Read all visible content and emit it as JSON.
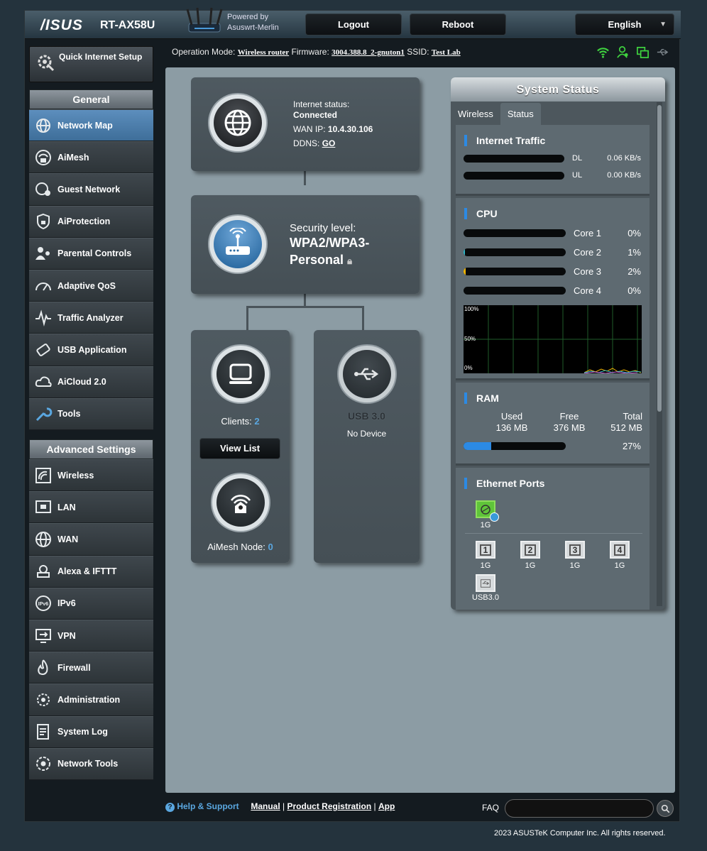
{
  "header": {
    "logo": "/ISUS",
    "model": "RT-AX58U",
    "powered_by": "Powered by",
    "firmware_brand": "Asuswrt-Merlin",
    "logout": "Logout",
    "reboot": "Reboot",
    "language": "English"
  },
  "info_bar": {
    "op_mode_label": "Operation Mode:",
    "op_mode_value": "Wireless router",
    "firmware_label": "Firmware:",
    "firmware_value": "3004.388.8_2-gnuton1",
    "ssid_label": "SSID:",
    "ssid_value": "Test Lab"
  },
  "sidebar": {
    "quick_setup": "Quick Internet Setup",
    "general_title": "General",
    "general_items": [
      {
        "label": "Network Map",
        "icon": "network-map-icon",
        "active": true
      },
      {
        "label": "AiMesh",
        "icon": "aimesh-icon"
      },
      {
        "label": "Guest Network",
        "icon": "guest-network-icon"
      },
      {
        "label": "AiProtection",
        "icon": "aiprotection-icon"
      },
      {
        "label": "Parental Controls",
        "icon": "parental-controls-icon"
      },
      {
        "label": "Adaptive QoS",
        "icon": "adaptive-qos-icon"
      },
      {
        "label": "Traffic Analyzer",
        "icon": "traffic-analyzer-icon"
      },
      {
        "label": "USB Application",
        "icon": "usb-application-icon"
      },
      {
        "label": "AiCloud 2.0",
        "icon": "aicloud-icon"
      },
      {
        "label": "Tools",
        "icon": "tools-icon"
      }
    ],
    "advanced_title": "Advanced Settings",
    "advanced_items": [
      {
        "label": "Wireless",
        "icon": "wireless-icon"
      },
      {
        "label": "LAN",
        "icon": "lan-icon"
      },
      {
        "label": "WAN",
        "icon": "wan-icon"
      },
      {
        "label": "Alexa & IFTTT",
        "icon": "alexa-icon"
      },
      {
        "label": "IPv6",
        "icon": "ipv6-icon"
      },
      {
        "label": "VPN",
        "icon": "vpn-icon"
      },
      {
        "label": "Firewall",
        "icon": "firewall-icon"
      },
      {
        "label": "Administration",
        "icon": "administration-icon"
      },
      {
        "label": "System Log",
        "icon": "system-log-icon"
      },
      {
        "label": "Network Tools",
        "icon": "network-tools-icon"
      }
    ]
  },
  "network_map": {
    "internet_status_label": "Internet status:",
    "internet_status_value": "Connected",
    "wan_ip_label": "WAN IP:",
    "wan_ip_value": "10.4.30.106",
    "ddns_label": "DDNS:",
    "ddns_value": "GO",
    "security_level_label": "Security level:",
    "security_value_line1": "WPA2/WPA3-",
    "security_value_line2": "Personal",
    "clients_label": "Clients:",
    "clients_count": "2",
    "view_list": "View List",
    "aimesh_label": "AiMesh Node:",
    "aimesh_count": "0",
    "usb_label": "USB 3.0",
    "usb_status": "No Device"
  },
  "system_status": {
    "title": "System Status",
    "tab_wireless": "Wireless",
    "tab_status": "Status",
    "traffic": {
      "title": "Internet Traffic",
      "dl_label": "DL",
      "dl_value": "0.06 KB/s",
      "ul_label": "UL",
      "ul_value": "0.00 KB/s"
    },
    "cpu": {
      "title": "CPU",
      "cores": [
        {
          "label": "Core 1",
          "value": "0%",
          "pct": 0,
          "color": "#2c8ae4"
        },
        {
          "label": "Core 2",
          "value": "1%",
          "pct": 1,
          "color": "#2fb7c9"
        },
        {
          "label": "Core 3",
          "value": "2%",
          "pct": 2,
          "color": "#f0b400"
        },
        {
          "label": "Core 4",
          "value": "0%",
          "pct": 0,
          "color": "#2c8ae4"
        }
      ],
      "graph_100": "100%",
      "graph_50": "50%",
      "graph_0": "0%"
    },
    "ram": {
      "title": "RAM",
      "used_label": "Used",
      "used_value": "136 MB",
      "free_label": "Free",
      "free_value": "376 MB",
      "total_label": "Total",
      "total_value": "512 MB",
      "percent": "27%",
      "pct": 27,
      "bar_color": "#2c8ae4"
    },
    "ethernet": {
      "title": "Ethernet Ports",
      "wan_speed": "1G",
      "lan_ports": [
        {
          "num": "1",
          "speed": "1G"
        },
        {
          "num": "2",
          "speed": "1G"
        },
        {
          "num": "3",
          "speed": "1G"
        },
        {
          "num": "4",
          "speed": "1G"
        }
      ],
      "usb_label": "USB3.0"
    }
  },
  "footer": {
    "help": "Help & Support",
    "manual": "Manual",
    "product_registration": "Product Registration",
    "app": "App",
    "faq": "FAQ",
    "copyright": "2023 ASUSTeK Computer Inc. All rights reserved."
  }
}
